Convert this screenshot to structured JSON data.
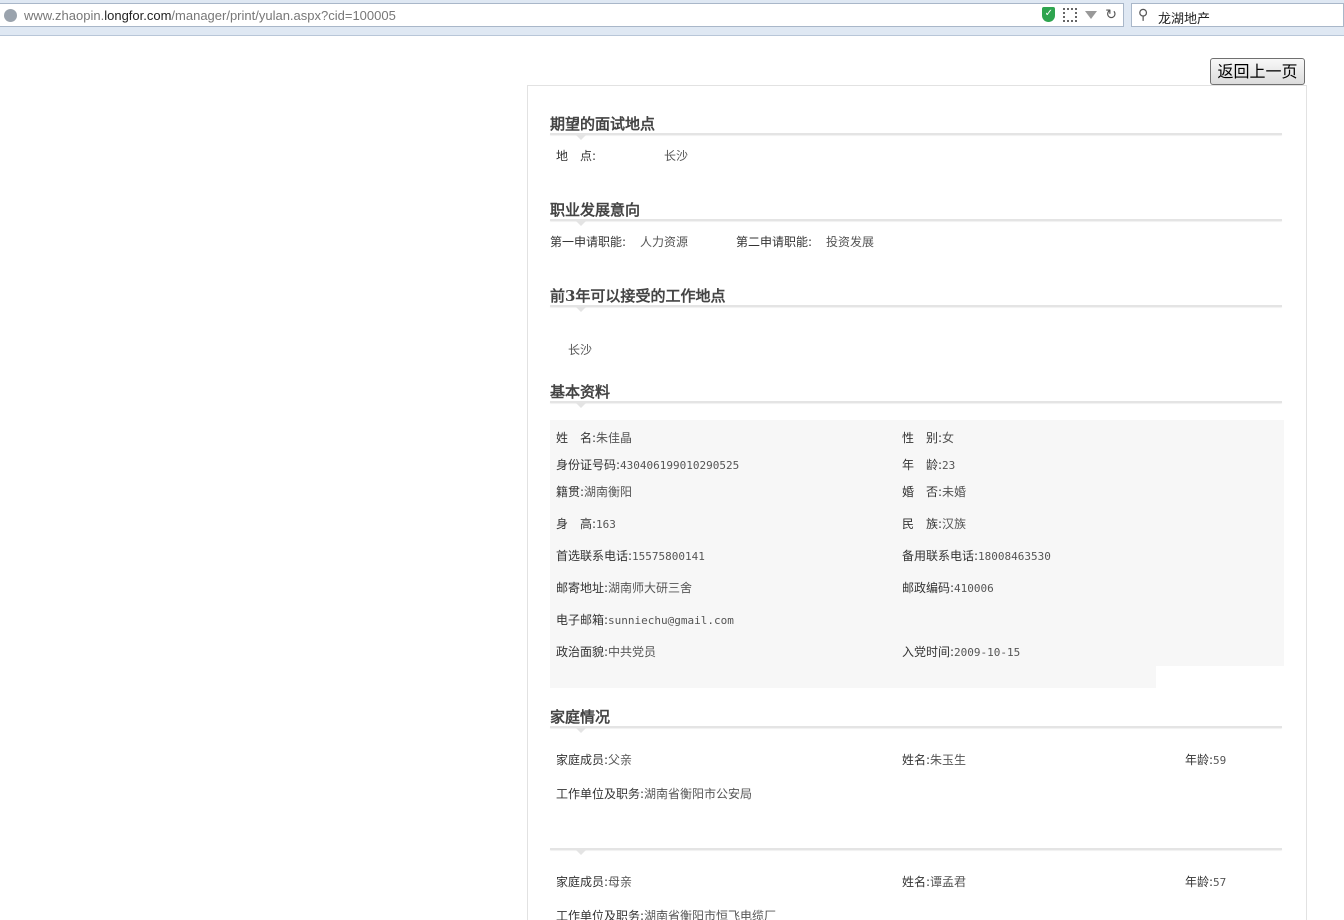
{
  "browser": {
    "url_prefix": "www.zhaopin.",
    "url_domain": "longfor.com",
    "url_path": "/manager/print/yulan.aspx?cid=100005",
    "search_text": "龙湖地产"
  },
  "back_button": "返回上一页",
  "interview": {
    "title": "期望的面试地点",
    "location_label": "地　点:",
    "location_value": "长沙"
  },
  "career": {
    "title": "职业发展意向",
    "first_label": "第一申请职能:",
    "first_value": "人力资源",
    "second_label": "第二申请职能:",
    "second_value": "投资发展"
  },
  "work_location": {
    "title": "前3年可以接受的工作地点",
    "value": "长沙"
  },
  "basic": {
    "title": "基本资料",
    "name_label": "姓　名:",
    "name_value": "朱佳晶",
    "gender_label": "性　别:",
    "gender_value": "女",
    "id_label": "身份证号码:",
    "id_value": "430406199010290525",
    "age_label": "年　龄:",
    "age_value": "23",
    "hometown_label": "籍贯:",
    "hometown_value": "湖南衡阳",
    "marital_label": "婚　否:",
    "marital_value": "未婚",
    "height_label": "身　高:",
    "height_value": "163",
    "ethnic_label": "民　族:",
    "ethnic_value": "汉族",
    "phone_label": "首选联系电话:",
    "phone_value": "15575800141",
    "alt_phone_label": "备用联系电话:",
    "alt_phone_value": "18008463530",
    "address_label": "邮寄地址:",
    "address_value": "湖南师大研三舍",
    "zip_label": "邮政编码:",
    "zip_value": "410006",
    "email_label": "电子邮箱:",
    "email_value": "sunniechu@gmail.com",
    "political_label": "政治面貌:",
    "political_value": "中共党员",
    "join_label": "入党时间:",
    "join_value": "2009-10-15"
  },
  "family": {
    "title": "家庭情况",
    "member_label": "家庭成员:",
    "name_label": "姓名:",
    "age_label": "年龄:",
    "work_label": "工作单位及职务:",
    "members": [
      {
        "relation": "父亲",
        "name": "朱玉生",
        "age": "59",
        "work": "湖南省衡阳市公安局"
      },
      {
        "relation": "母亲",
        "name": "谭孟君",
        "age": "57",
        "work": "湖南省衡阳市恒飞电缆厂"
      }
    ]
  }
}
